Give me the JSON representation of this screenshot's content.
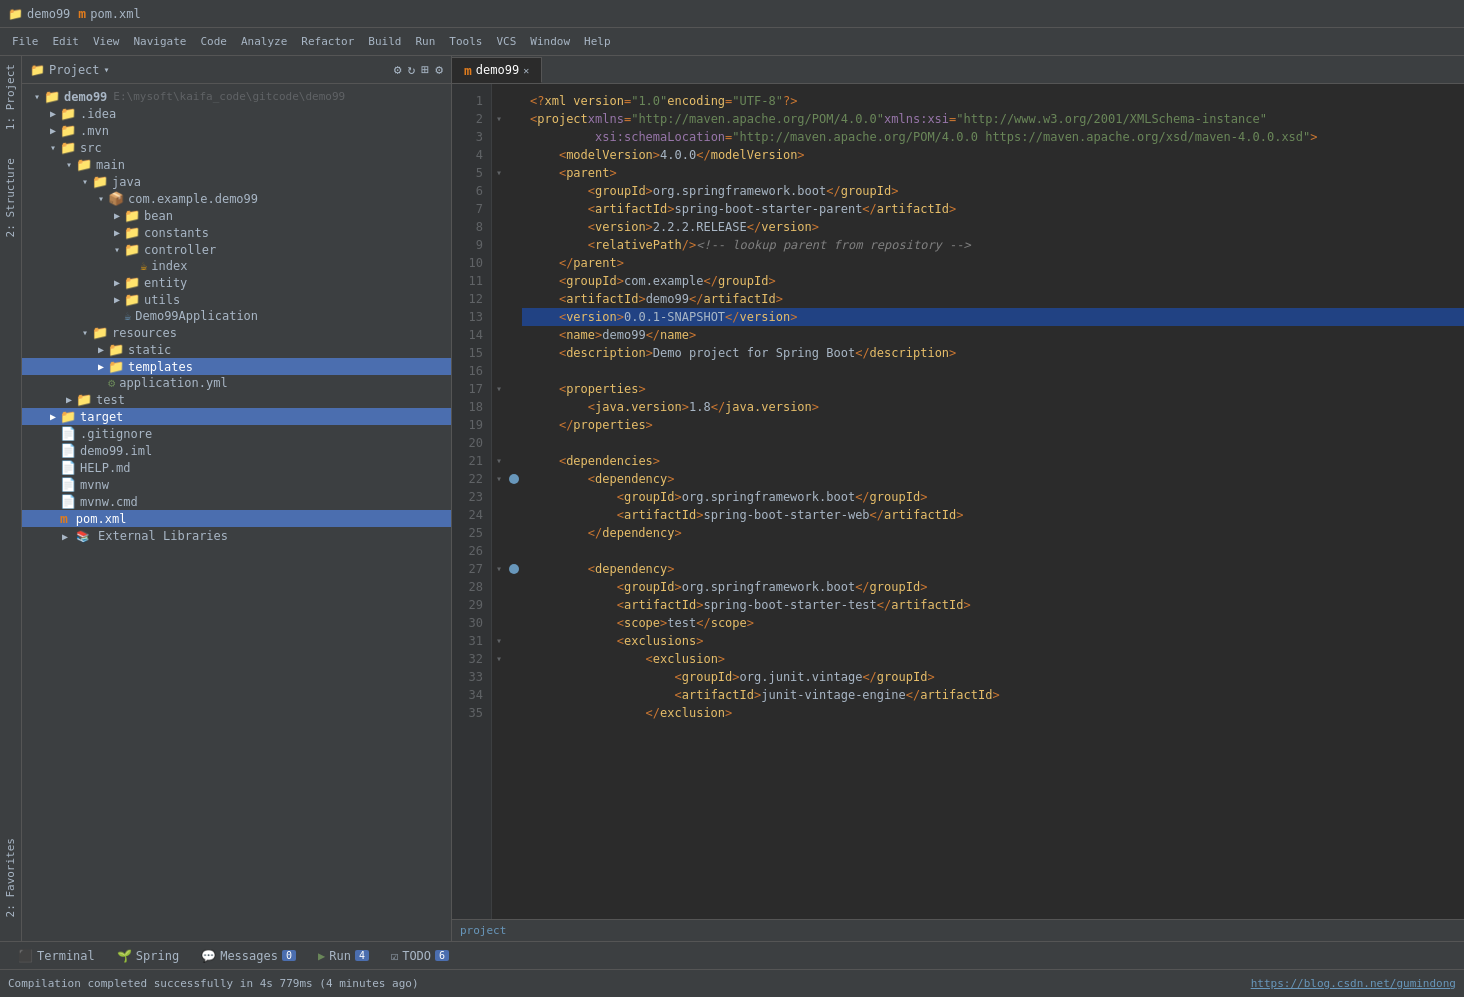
{
  "titleBar": {
    "project1Label": "demo99",
    "project1Icon": "📁",
    "project2Label": "pom.xml",
    "project2Icon": "m"
  },
  "projectPanel": {
    "headerLabel": "Project",
    "dropdownIcon": "▾",
    "settingsIcon": "⚙",
    "syncIcon": "↻",
    "gearIcon": "⚙",
    "expandIcon": "⊞"
  },
  "fileTree": [
    {
      "id": "demo99",
      "label": "demo99",
      "path": "E:\\mysoft\\kaifa_code\\gitcode\\demo99",
      "type": "project",
      "depth": 0,
      "expanded": true
    },
    {
      "id": "idea",
      "label": ".idea",
      "type": "folder",
      "depth": 1,
      "expanded": false
    },
    {
      "id": "mvn",
      "label": ".mvn",
      "type": "folder",
      "depth": 1,
      "expanded": false
    },
    {
      "id": "src",
      "label": "src",
      "type": "folder",
      "depth": 1,
      "expanded": true
    },
    {
      "id": "main",
      "label": "main",
      "type": "folder",
      "depth": 2,
      "expanded": true
    },
    {
      "id": "java",
      "label": "java",
      "type": "folder",
      "depth": 3,
      "expanded": true
    },
    {
      "id": "com_example_demo99",
      "label": "com.example.demo99",
      "type": "package",
      "depth": 4,
      "expanded": true
    },
    {
      "id": "bean",
      "label": "bean",
      "type": "folder",
      "depth": 5,
      "expanded": false
    },
    {
      "id": "constants",
      "label": "constants",
      "type": "folder",
      "depth": 5,
      "expanded": false
    },
    {
      "id": "controller",
      "label": "controller",
      "type": "folder",
      "depth": 5,
      "expanded": true
    },
    {
      "id": "index_java",
      "label": "index",
      "type": "java",
      "depth": 6,
      "expanded": false
    },
    {
      "id": "entity",
      "label": "entity",
      "type": "folder",
      "depth": 5,
      "expanded": false
    },
    {
      "id": "utils",
      "label": "utils",
      "type": "folder",
      "depth": 5,
      "expanded": false
    },
    {
      "id": "Demo99Application",
      "label": "Demo99Application",
      "type": "java-main",
      "depth": 5,
      "expanded": false
    },
    {
      "id": "resources",
      "label": "resources",
      "type": "folder",
      "depth": 3,
      "expanded": true
    },
    {
      "id": "static",
      "label": "static",
      "type": "folder",
      "depth": 4,
      "expanded": false
    },
    {
      "id": "templates",
      "label": "templates",
      "type": "folder",
      "depth": 4,
      "expanded": false
    },
    {
      "id": "application_yml",
      "label": "application.yml",
      "type": "yaml",
      "depth": 4,
      "expanded": false
    },
    {
      "id": "test",
      "label": "test",
      "type": "folder",
      "depth": 2,
      "expanded": false
    },
    {
      "id": "target",
      "label": "target",
      "type": "folder-yellow",
      "depth": 1,
      "expanded": false,
      "selected": false
    },
    {
      "id": "gitignore",
      "label": ".gitignore",
      "type": "file",
      "depth": 1,
      "expanded": false
    },
    {
      "id": "demo99_iml",
      "label": "demo99.iml",
      "type": "iml",
      "depth": 1,
      "expanded": false
    },
    {
      "id": "HELP_md",
      "label": "HELP.md",
      "type": "md",
      "depth": 1,
      "expanded": false
    },
    {
      "id": "mvnw",
      "label": "mvnw",
      "type": "file",
      "depth": 1,
      "expanded": false
    },
    {
      "id": "mvnw_cmd",
      "label": "mvnw.cmd",
      "type": "file",
      "depth": 1,
      "expanded": false
    },
    {
      "id": "pom_xml",
      "label": "pom.xml",
      "type": "xml",
      "depth": 1,
      "expanded": false,
      "selected": true
    },
    {
      "id": "external_libraries",
      "label": "External Libraries",
      "type": "libraries",
      "depth": 0,
      "expanded": false
    }
  ],
  "editorTabs": [
    {
      "id": "demo99-tab",
      "label": "demo99",
      "icon": "m",
      "active": true
    }
  ],
  "codeLines": [
    {
      "num": 1,
      "fold": "",
      "bookmark": false,
      "content": "xml_decl",
      "text": "<?xml version=\"1.0\" encoding=\"UTF-8\"?>"
    },
    {
      "num": 2,
      "fold": "▾",
      "bookmark": false,
      "content": "project_open",
      "text": "<project xmlns=\"http://maven.apache.org/POM/4.0.0\" xmlns:xsi=\"http://www.w3.org/2001/XMLSchema-instance\""
    },
    {
      "num": 3,
      "fold": "",
      "bookmark": false,
      "content": "indent_text",
      "text": "         xsi:schemaLocation=\"http://maven.apache.org/POM/4.0.0 https://maven.apache.org/xsd/maven-4.0.0.xsd\">"
    },
    {
      "num": 4,
      "fold": "",
      "bookmark": false,
      "content": "simple_tag",
      "tag": "modelVersion",
      "value": "4.0.0",
      "text": "    <modelVersion>4.0.0</modelVersion>"
    },
    {
      "num": 5,
      "fold": "▾",
      "bookmark": false,
      "content": "open_tag",
      "tag": "parent",
      "text": "    <parent>"
    },
    {
      "num": 6,
      "fold": "",
      "bookmark": false,
      "content": "simple_tag",
      "text": "        <groupId>org.springframework.boot</groupId>"
    },
    {
      "num": 7,
      "fold": "",
      "bookmark": false,
      "content": "simple_tag",
      "text": "        <artifactId>spring-boot-starter-parent</artifactId>"
    },
    {
      "num": 8,
      "fold": "",
      "bookmark": false,
      "content": "simple_tag",
      "text": "        <version>2.2.2.RELEASE</version>"
    },
    {
      "num": 9,
      "fold": "",
      "bookmark": false,
      "content": "comment_tag",
      "text": "        <relativePath/> <!-- lookup parent from repository -->"
    },
    {
      "num": 10,
      "fold": "",
      "bookmark": false,
      "content": "close_tag",
      "tag": "parent",
      "text": "    </parent>"
    },
    {
      "num": 11,
      "fold": "",
      "bookmark": false,
      "content": "simple_tag",
      "text": "    <groupId>com.example</groupId>"
    },
    {
      "num": 12,
      "fold": "",
      "bookmark": false,
      "content": "simple_tag",
      "text": "    <artifactId>demo99</artifactId>"
    },
    {
      "num": 13,
      "fold": "",
      "bookmark": false,
      "content": "highlighted_tag",
      "text": "    <version>0.0.1-SNAPSHOT</version>",
      "highlighted": true
    },
    {
      "num": 14,
      "fold": "",
      "bookmark": false,
      "content": "simple_tag",
      "text": "    <name>demo99</name>"
    },
    {
      "num": 15,
      "fold": "",
      "bookmark": false,
      "content": "simple_tag",
      "text": "    <description>Demo project for Spring Boot</description>"
    },
    {
      "num": 16,
      "fold": "",
      "bookmark": false,
      "content": "empty",
      "text": ""
    },
    {
      "num": 17,
      "fold": "▾",
      "bookmark": false,
      "content": "open_tag",
      "text": "    <properties>"
    },
    {
      "num": 18,
      "fold": "",
      "bookmark": false,
      "content": "simple_tag",
      "text": "        <java.version>1.8</java.version>"
    },
    {
      "num": 19,
      "fold": "",
      "bookmark": false,
      "content": "close_tag",
      "text": "    </properties>"
    },
    {
      "num": 20,
      "fold": "",
      "bookmark": false,
      "content": "empty",
      "text": ""
    },
    {
      "num": 21,
      "fold": "▾",
      "bookmark": false,
      "content": "open_tag",
      "text": "    <dependencies>"
    },
    {
      "num": 22,
      "fold": "▾",
      "bookmark": true,
      "content": "open_tag",
      "text": "        <dependency>"
    },
    {
      "num": 23,
      "fold": "",
      "bookmark": false,
      "content": "simple_tag",
      "text": "            <groupId>org.springframework.boot</groupId>"
    },
    {
      "num": 24,
      "fold": "",
      "bookmark": false,
      "content": "simple_tag",
      "text": "            <artifactId>spring-boot-starter-web</artifactId>"
    },
    {
      "num": 25,
      "fold": "",
      "bookmark": false,
      "content": "close_tag",
      "text": "        </dependency>"
    },
    {
      "num": 26,
      "fold": "",
      "bookmark": false,
      "content": "empty",
      "text": ""
    },
    {
      "num": 27,
      "fold": "▾",
      "bookmark": true,
      "content": "open_tag",
      "text": "        <dependency>"
    },
    {
      "num": 28,
      "fold": "",
      "bookmark": false,
      "content": "simple_tag",
      "text": "            <groupId>org.springframework.boot</groupId>"
    },
    {
      "num": 29,
      "fold": "",
      "bookmark": false,
      "content": "simple_tag",
      "text": "            <artifactId>spring-boot-starter-test</artifactId>"
    },
    {
      "num": 30,
      "fold": "",
      "bookmark": false,
      "content": "simple_tag",
      "text": "            <scope>test</scope>"
    },
    {
      "num": 31,
      "fold": "▾",
      "bookmark": false,
      "content": "open_tag",
      "text": "            <exclusions>"
    },
    {
      "num": 32,
      "fold": "▾",
      "bookmark": false,
      "content": "open_tag",
      "text": "                <exclusion>"
    },
    {
      "num": 33,
      "fold": "",
      "bookmark": false,
      "content": "simple_tag",
      "text": "                    <groupId>org.junit.vintage</groupId>"
    },
    {
      "num": 34,
      "fold": "",
      "bookmark": false,
      "content": "simple_tag",
      "text": "                    <artifactId>junit-vintage-engine</artifactId>"
    },
    {
      "num": 35,
      "fold": "",
      "bookmark": false,
      "content": "close_tag",
      "text": "                </exclusion>"
    }
  ],
  "bottomTabs": [
    {
      "id": "terminal",
      "label": "Terminal",
      "icon": "⬛",
      "badge": null
    },
    {
      "id": "spring",
      "label": "Spring",
      "icon": "🌱",
      "badge": null
    },
    {
      "id": "messages",
      "label": "Messages",
      "icon": "💬",
      "badge": "0"
    },
    {
      "id": "run",
      "label": "Run",
      "icon": "▶",
      "badge": "4"
    },
    {
      "id": "todo",
      "label": "TODO",
      "icon": "☑",
      "badge": "6"
    }
  ],
  "statusBar": {
    "message": "Compilation completed successfully in 4s 779ms (4 minutes ago)",
    "link": "https://blog.csdn.net/gumindong"
  },
  "breadcrumb": "project",
  "sideStrip": {
    "items": [
      "1: Project",
      "2: Structure",
      "2: Favorites"
    ]
  }
}
